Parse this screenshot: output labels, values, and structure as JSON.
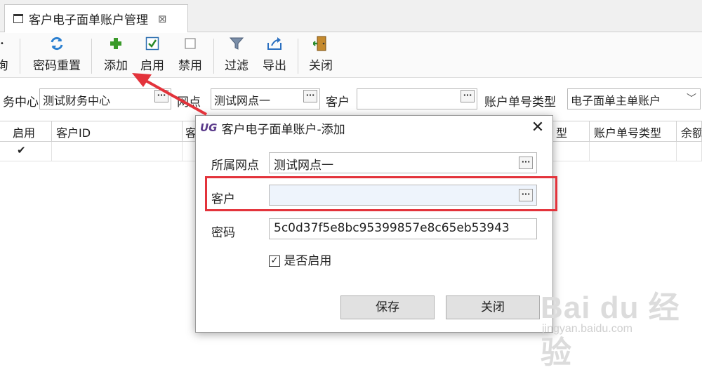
{
  "tab": {
    "title": "客户电子面单账户管理",
    "close_glyph": "⊠"
  },
  "toolbar": {
    "partial_left": "询",
    "buttons": [
      {
        "label": "密码重置",
        "icon": "refresh-icon"
      },
      {
        "label": "添加",
        "icon": "add-icon"
      },
      {
        "label": "启用",
        "icon": "checkbox-checked-icon"
      },
      {
        "label": "禁用",
        "icon": "checkbox-empty-icon"
      },
      {
        "label": "过滤",
        "icon": "filter-icon"
      },
      {
        "label": "导出",
        "icon": "export-icon"
      },
      {
        "label": "关闭",
        "icon": "exit-door-icon"
      }
    ]
  },
  "filters": {
    "finance_center_label": "务中心",
    "finance_center_value": "测试财务中心",
    "site_label": "网点",
    "site_value": "测试网点一",
    "customer_label": "客户",
    "customer_value": "",
    "acct_type_label": "账户单号类型",
    "acct_type_value": "电子面单主单账户"
  },
  "grid": {
    "headers": [
      "启用",
      "客户ID",
      "客",
      "型",
      "账户单号类型",
      "余额"
    ],
    "row_checked": "✔"
  },
  "dialog": {
    "title": "客户电子面单账户-添加",
    "logo_text": "UG",
    "site_label": "所属网点",
    "site_value": "测试网点一",
    "customer_label": "客户",
    "customer_value": "",
    "password_label": "密码",
    "password_value": "5c0d37f5e8bc95399857e8c65eb53943",
    "enable_label": "是否启用",
    "enable_checked": "✓",
    "save_label": "保存",
    "close_label": "关闭",
    "close_glyph": "✕"
  },
  "watermark": {
    "big": "Bai du 经验",
    "small": "jingyan.baidu.com"
  },
  "colors": {
    "highlight": "#e3333b",
    "accent_green": "#3a9a2a",
    "accent_blue": "#2a7fd0"
  }
}
